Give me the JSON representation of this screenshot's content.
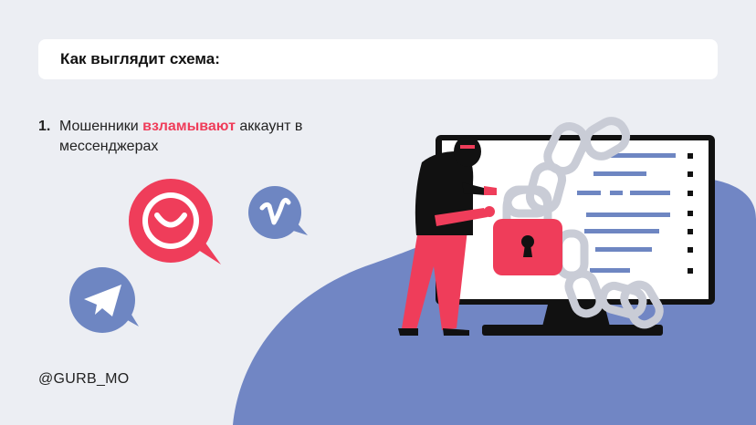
{
  "header": {
    "title": "Как выглядит схема:"
  },
  "step": {
    "number": "1.",
    "text_before": "Мошенники ",
    "highlight": "взламывают",
    "text_after": " аккаунт в мессенджерах"
  },
  "footer": {
    "handle": "@GURB_MO"
  },
  "icons": [
    "phone-chat-icon",
    "vimeo-icon",
    "telegram-icon",
    "monitor-icon",
    "padlock-icon",
    "chain-icon",
    "hacker-figure"
  ],
  "colors": {
    "accent": "#ef3d5a",
    "blob": "#7186c4",
    "icon_blue": "#6e86c2",
    "background": "#eceef3"
  }
}
